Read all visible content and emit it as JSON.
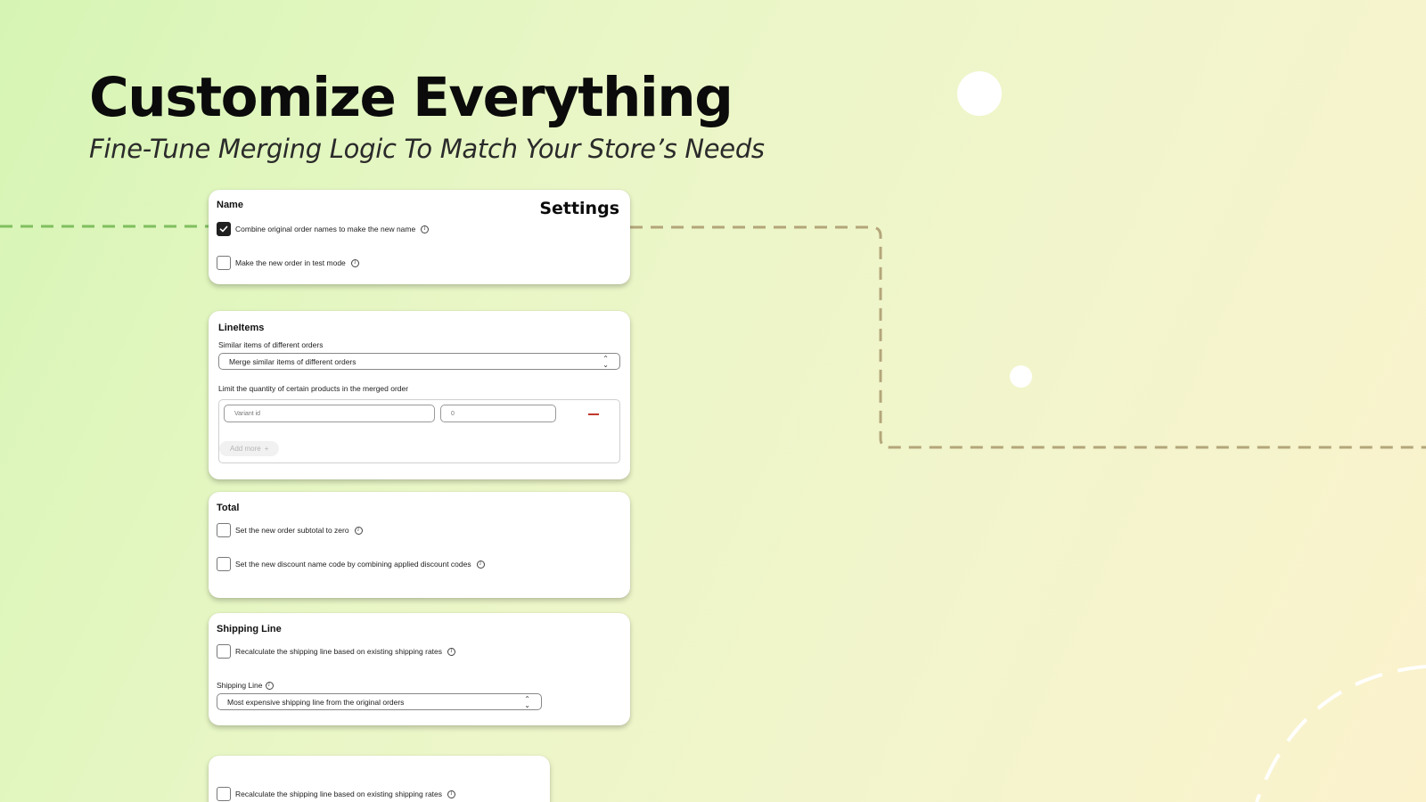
{
  "hero": {
    "title": "Customize Everything",
    "subtitle": "Fine-Tune Merging Logic To Match Your Store’s Needs"
  },
  "colors": {
    "background_start": "#d6f5b4",
    "background_end": "#fbf2cc",
    "dash_left": "#7fbf5f",
    "dash_right": "#b3a67a",
    "checkbox_checked": "#1f1f1f",
    "remove_icon": "#c0392b"
  },
  "name_card": {
    "section_title": "Name",
    "settings_title": "Settings",
    "options": [
      {
        "label": "Combine original order names to make the new name",
        "checked": true,
        "icon": "info-icon"
      },
      {
        "label": "Make the new order in test mode",
        "checked": false,
        "icon": "info-icon"
      }
    ]
  },
  "lineitems_card": {
    "section_title": "LineItems",
    "similar_label": "Similar items of different orders",
    "similar_select_value": "Merge similar items of different orders",
    "limit_label": "Limit the quantity of certain products in the merged order",
    "variant_placeholder": "Variant id",
    "quantity_value": "0",
    "add_more_label": "Add more",
    "add_more_icon": "+"
  },
  "total_card": {
    "section_title": "Total",
    "options": [
      {
        "label": "Set the new order subtotal to zero",
        "checked": false,
        "icon": "info-icon"
      },
      {
        "label": "Set the new discount name code by combining applied discount codes",
        "checked": false,
        "icon": "info-icon"
      }
    ]
  },
  "shipping_card": {
    "section_title": "Shipping Line",
    "recalc_label": "Recalculate the shipping line based on existing shipping rates",
    "shipping_line_label": "Shipping Line",
    "shipping_select_value": "Most expensive shipping line from the original orders"
  },
  "extra_card": {
    "recalc_label": "Recalculate the shipping line based on existing shipping rates"
  },
  "icons": {
    "info": "i",
    "check": "✓",
    "chevron_up": "⌃",
    "chevron_down": "⌄"
  }
}
